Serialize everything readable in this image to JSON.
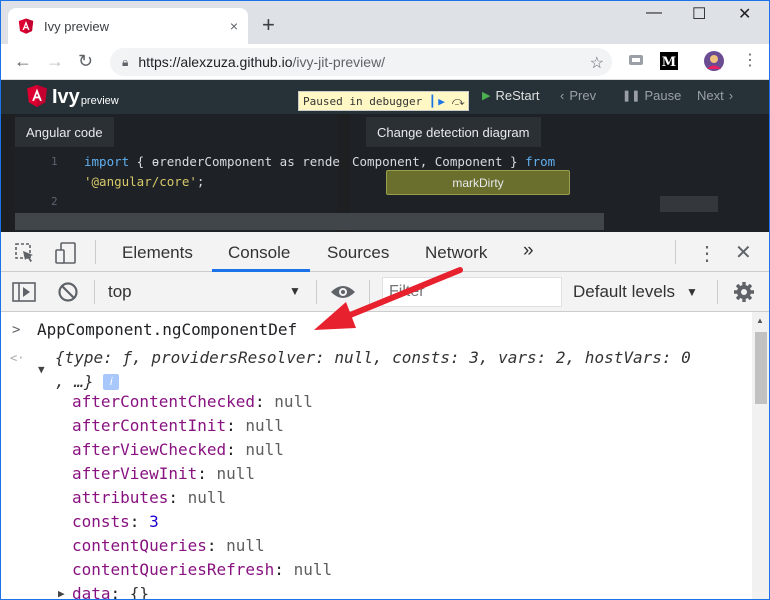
{
  "browser": {
    "tab_title": "Ivy preview",
    "tab_close": "×",
    "new_tab": "+",
    "window_controls": {
      "minimize": "—",
      "maximize": "☐",
      "close": "✕"
    },
    "url_host": "https://alexzuza.github.io",
    "url_path": "/ivy-jit-preview/"
  },
  "app": {
    "logo_text": "Ivy",
    "logo_sub": "preview",
    "debugger_status": "Paused in debugger",
    "buttons": {
      "restart": "ReStart",
      "prev": "Prev",
      "pause": "Pause",
      "next": "Next"
    },
    "left_pane_title": "Angular code",
    "right_pane_title": "Change detection diagram",
    "code": {
      "line1_num": "1",
      "line2_num": "2",
      "line1_kw_import": "import",
      "line1_mid": " { ɵrenderComponent as rende",
      "line1_right": "Component, Component } ",
      "line1_kw_from": "from",
      "line1_str": "'@angular/core'",
      "line1_semicolon": ";"
    },
    "diagram_node": "markDirty"
  },
  "devtools": {
    "tabs": [
      "Elements",
      "Console",
      "Sources",
      "Network"
    ],
    "more_tabs": "»",
    "active_tab": "Console",
    "context": "top",
    "filter_placeholder": "Filter",
    "levels": "Default levels"
  },
  "console": {
    "input_expression": "AppComponent.ngComponentDef",
    "summary_line1": "{type: ƒ, providersResolver: null, consts: 3, vars: 2, hostVars: 0",
    "summary_line2": ", …}",
    "info_badge": "i",
    "properties": [
      {
        "key": "afterContentChecked",
        "value": "null",
        "kind": "null"
      },
      {
        "key": "afterContentInit",
        "value": "null",
        "kind": "null"
      },
      {
        "key": "afterViewChecked",
        "value": "null",
        "kind": "null"
      },
      {
        "key": "afterViewInit",
        "value": "null",
        "kind": "null"
      },
      {
        "key": "attributes",
        "value": "null",
        "kind": "null"
      },
      {
        "key": "consts",
        "value": "3",
        "kind": "number"
      },
      {
        "key": "contentQueries",
        "value": "null",
        "kind": "null"
      },
      {
        "key": "contentQueriesRefresh",
        "value": "null",
        "kind": "null"
      },
      {
        "key": "data",
        "value": "{}",
        "kind": "object"
      }
    ]
  },
  "colors": {
    "annotation_arrow": "#e8212e",
    "devtools_accent": "#1a73e8",
    "property_key": "#881280"
  }
}
